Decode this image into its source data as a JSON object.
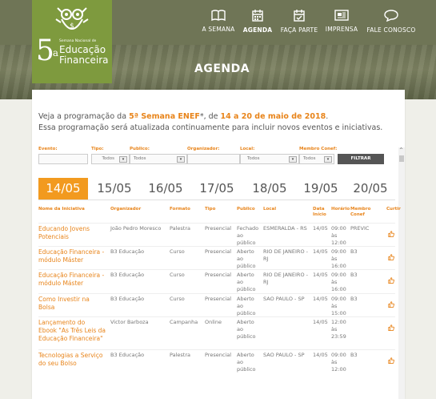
{
  "logo": {
    "number": "5",
    "superscript": "a",
    "small": "Semana Nacional de",
    "line1": "Educação",
    "line2": "Financeira"
  },
  "nav": [
    {
      "label": "A SEMANA",
      "icon": "book-icon"
    },
    {
      "label": "AGENDA",
      "icon": "calendar-icon",
      "active": true
    },
    {
      "label": "FAÇA PARTE",
      "icon": "calendar-check-icon"
    },
    {
      "label": "IMPRENSA",
      "icon": "newspaper-icon"
    },
    {
      "label": "FALE CONOSCO",
      "icon": "chat-bubble-icon"
    }
  ],
  "page_title": "AGENDA",
  "intro": {
    "prefix": "Veja a programação da ",
    "highlight1": "5ª Semana ENEF",
    "middle": "*, de ",
    "highlight2": "14 a 20 de maio de 2018",
    "suffix": ".",
    "line2": "Essa programação será atualizada continuamente para incluir novos eventos e iniciativas."
  },
  "filters": {
    "evento": {
      "label": "Evento:",
      "value": ""
    },
    "tipo": {
      "label": "Tipo:",
      "value": "Todos"
    },
    "publico": {
      "label": "Publico:",
      "value": "Todos"
    },
    "organizador": {
      "label": "Organizador:",
      "value": ""
    },
    "local": {
      "label": "Local:",
      "value": "Todos"
    },
    "membro": {
      "label": "Membro Conef:",
      "value": "Todos"
    },
    "button": "FILTRAR"
  },
  "dates": [
    "14/05",
    "15/05",
    "16/05",
    "17/05",
    "18/05",
    "19/05",
    "20/05"
  ],
  "columns": [
    "Nome da Iniciativa",
    "Organizador",
    "Formato",
    "Tipo",
    "Publico",
    "Local",
    "Data Início",
    "Horário",
    "Membro Conef",
    "Curtir"
  ],
  "rows": [
    {
      "name": [
        "Educando Jovens",
        "Potenciais"
      ],
      "org": [
        "João Pedro Moresco"
      ],
      "formato": [
        "Palestra"
      ],
      "tipo": [
        "Presencial"
      ],
      "publico": [
        "Fechado",
        "ao",
        "público"
      ],
      "local": [
        "ESMERALDA - RS"
      ],
      "data": [
        "14/05"
      ],
      "hora": [
        "09:00",
        "às",
        "12:00"
      ],
      "membro": [
        "PREVIC"
      ]
    },
    {
      "name": [
        "Educação Financeira -",
        "módulo Máster"
      ],
      "org": [
        "B3 Educação"
      ],
      "formato": [
        "Curso"
      ],
      "tipo": [
        "Presencial"
      ],
      "publico": [
        "Aberto",
        "ao",
        "público"
      ],
      "local": [
        "RIO DE JANEIRO -",
        "RJ"
      ],
      "data": [
        "14/05"
      ],
      "hora": [
        "09:00",
        "às",
        "16:00"
      ],
      "membro": [
        "B3"
      ]
    },
    {
      "name": [
        "Educação Financeira -",
        "módulo Máster"
      ],
      "org": [
        "B3 Educação"
      ],
      "formato": [
        "Curso"
      ],
      "tipo": [
        "Presencial"
      ],
      "publico": [
        "Aberto",
        "ao",
        "público"
      ],
      "local": [
        "RIO DE JANEIRO -",
        "RJ"
      ],
      "data": [
        "14/05"
      ],
      "hora": [
        "09:00",
        "às",
        "16:00"
      ],
      "membro": [
        "B3"
      ]
    },
    {
      "name": [
        "Como Investir na",
        "Bolsa"
      ],
      "org": [
        "B3 Educação"
      ],
      "formato": [
        "Curso"
      ],
      "tipo": [
        "Presencial"
      ],
      "publico": [
        "Aberto",
        "ao",
        "público"
      ],
      "local": [
        "SAO PAULO - SP"
      ],
      "data": [
        "14/05"
      ],
      "hora": [
        "09:00",
        "às",
        "15:00"
      ],
      "membro": [
        "B3"
      ]
    },
    {
      "name": [
        "Lançamento do",
        "Ebook \"As Três Leis da",
        "Educação Financeira\""
      ],
      "org": [
        "Victor Barboza"
      ],
      "formato": [
        "Campanha"
      ],
      "tipo": [
        "Online"
      ],
      "publico": [
        "Aberto",
        "ao",
        "público"
      ],
      "local": [
        ""
      ],
      "data": [
        "14/05"
      ],
      "hora": [
        "12:00",
        "às",
        "23:59"
      ],
      "membro": [
        ""
      ]
    },
    {
      "name": [
        "Tecnologias a Serviço",
        "do seu Bolso"
      ],
      "org": [
        "B3 Educação"
      ],
      "formato": [
        "Palestra"
      ],
      "tipo": [
        "Presencial"
      ],
      "publico": [
        "Aberto",
        "ao",
        "público"
      ],
      "local": [
        "SAO PAULO - SP"
      ],
      "data": [
        "14/05"
      ],
      "hora": [
        "09:00",
        "às",
        "12:00"
      ],
      "membro": [
        "B3"
      ]
    }
  ]
}
